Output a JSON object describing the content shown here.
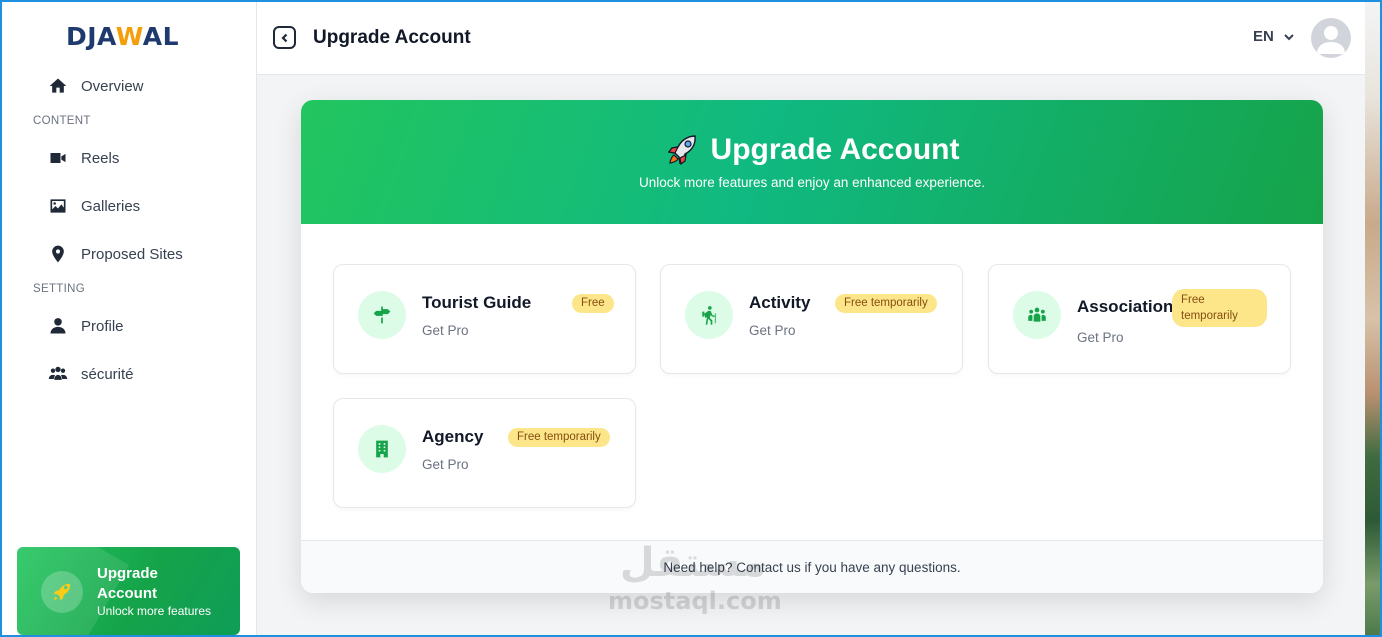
{
  "brand": {
    "name_part1": "DJA",
    "name_w": "W",
    "name_part2": "AL"
  },
  "sidebar": {
    "items": [
      {
        "label": "Overview",
        "icon": "home-icon"
      },
      {
        "label": "Reels",
        "icon": "video-icon"
      },
      {
        "label": "Galleries",
        "icon": "image-icon"
      },
      {
        "label": "Proposed Sites",
        "icon": "map-pin-icon"
      },
      {
        "label": "Profile",
        "icon": "user-icon"
      },
      {
        "label": "sécurité",
        "icon": "users-icon"
      }
    ],
    "sections": [
      "CONTENT",
      "SETTING"
    ],
    "promo": {
      "title": "Upgrade Account",
      "subtitle": "Unlock more features",
      "icon": "rocket-icon"
    }
  },
  "header": {
    "title": "Upgrade Account",
    "language": "EN"
  },
  "hero": {
    "title": "Upgrade Account",
    "subtitle": "Unlock more features and enjoy an enhanced experience."
  },
  "options": [
    {
      "title": "Tourist Guide",
      "subtitle": "Get Pro",
      "badge": "Free",
      "icon": "signpost-icon"
    },
    {
      "title": "Activity",
      "subtitle": "Get Pro",
      "badge": "Free temporarily",
      "icon": "hiking-icon"
    },
    {
      "title": "Association",
      "subtitle": "Get Pro",
      "badge": "Free temporarily",
      "icon": "people-group-icon"
    },
    {
      "title": "Agency",
      "subtitle": "Get Pro",
      "badge": "Free temporarily",
      "icon": "building-icon"
    }
  ],
  "footer": {
    "text": "Need help? Contact us if you have any questions."
  },
  "watermark": {
    "arabic": "مستقل",
    "latin": "mostaql.com"
  },
  "colors": {
    "accent": "#22c55e",
    "brand_navy": "#1e3a6e",
    "brand_orange": "#f59e0b",
    "badge_bg": "#fde68a"
  }
}
